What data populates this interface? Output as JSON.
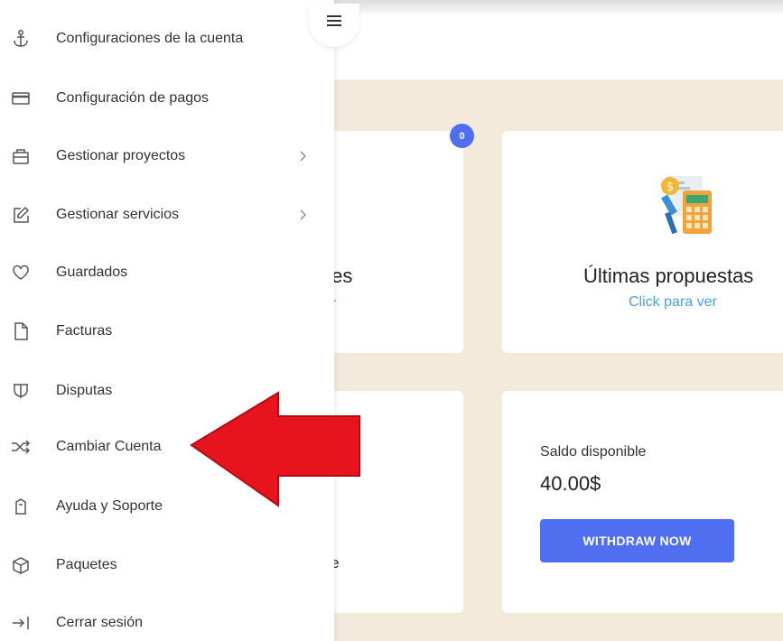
{
  "sidebar": {
    "items": [
      {
        "label": "Configuraciones de la cuenta",
        "icon": "anchor-icon",
        "has_submenu": false
      },
      {
        "label": "Configuración de pagos",
        "icon": "credit-card-icon",
        "has_submenu": false
      },
      {
        "label": "Gestionar proyectos",
        "icon": "briefcase-icon",
        "has_submenu": true
      },
      {
        "label": "Gestionar servicios",
        "icon": "edit-icon",
        "has_submenu": true
      },
      {
        "label": "Guardados",
        "icon": "heart-icon",
        "has_submenu": false
      },
      {
        "label": "Facturas",
        "icon": "file-icon",
        "has_submenu": false
      },
      {
        "label": "Disputas",
        "icon": "shield-split-icon",
        "has_submenu": false
      },
      {
        "label": "Cambiar Cuenta",
        "icon": "shuffle-icon",
        "has_submenu": false
      },
      {
        "label": "Ayuda y Soporte",
        "icon": "bookmark-icon",
        "has_submenu": false
      },
      {
        "label": "Paquetes",
        "icon": "package-icon",
        "has_submenu": false
      },
      {
        "label": "Cerrar sesión",
        "icon": "logout-icon",
        "has_submenu": false
      }
    ]
  },
  "dashboard": {
    "messages_card": {
      "badge": "0",
      "title_partial": "ajes",
      "link_partial": "r"
    },
    "proposals_card": {
      "title": "Últimas propuestas",
      "link": "Click para ver"
    },
    "pending_card": {
      "title_partial": "nte"
    },
    "balance_card": {
      "label": "Saldo disponible",
      "value": "40.00$",
      "button": "WITHDRAW NOW"
    }
  },
  "colors": {
    "accent": "#4f6ff0",
    "link": "#4a9fe0",
    "background": "#f3eadb",
    "annotation_arrow": "#e8141d"
  }
}
